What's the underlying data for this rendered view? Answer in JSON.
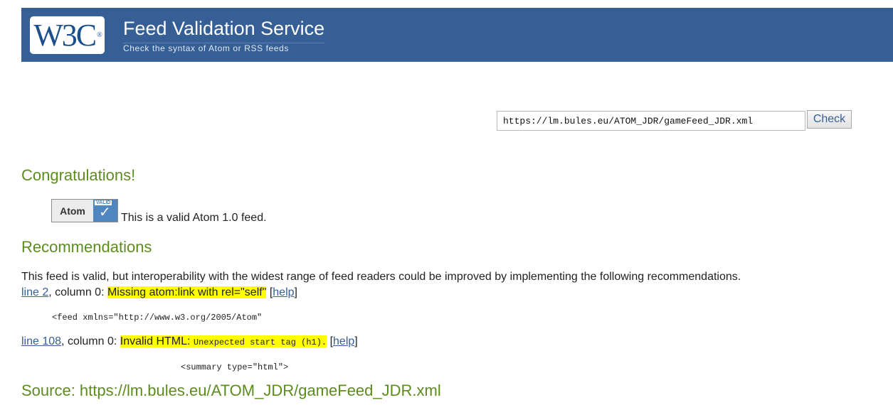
{
  "header": {
    "logo_text": "W3C",
    "logo_mark": "®",
    "title": "Feed Validation Service",
    "subtitle": "Check the syntax of Atom or RSS feeds"
  },
  "form": {
    "url_value": "https://lm.bules.eu/ATOM_JDR/gameFeed_JDR.xml",
    "check_label": "Check"
  },
  "result": {
    "heading": "Congratulations!",
    "badge_label": "Atom",
    "badge_valid": "VALID",
    "badge_check": "✓",
    "valid_text": "This is a valid Atom 1.0 feed."
  },
  "recommendations": {
    "heading": "Recommendations",
    "intro": "This feed is valid, but interoperability with the widest range of feed readers could be improved by implementing the following recommendations.",
    "items": [
      {
        "line_link": "line 2",
        "column_text": ", column 0: ",
        "message": "Missing atom:link with rel=\"self\"",
        "message_code": "",
        "help_open": " [",
        "help": "help",
        "help_close": "]",
        "code": "<feed xmlns=\"http://www.w3.org/2005/Atom\""
      },
      {
        "line_link": "line 108",
        "column_text": ", column 0: ",
        "message": "Invalid HTML: ",
        "message_code": "Unexpected start tag (h1).",
        "help_open": " [",
        "help": "help",
        "help_close": "]",
        "code": "<summary type=\"html\">"
      }
    ]
  },
  "source": {
    "text": "Source: https://lm.bules.eu/ATOM_JDR/gameFeed_JDR.xml"
  },
  "colors": {
    "banner": "#355f95",
    "heading": "#5d8c1e",
    "highlight": "#ffff00",
    "link": "#355f95"
  }
}
